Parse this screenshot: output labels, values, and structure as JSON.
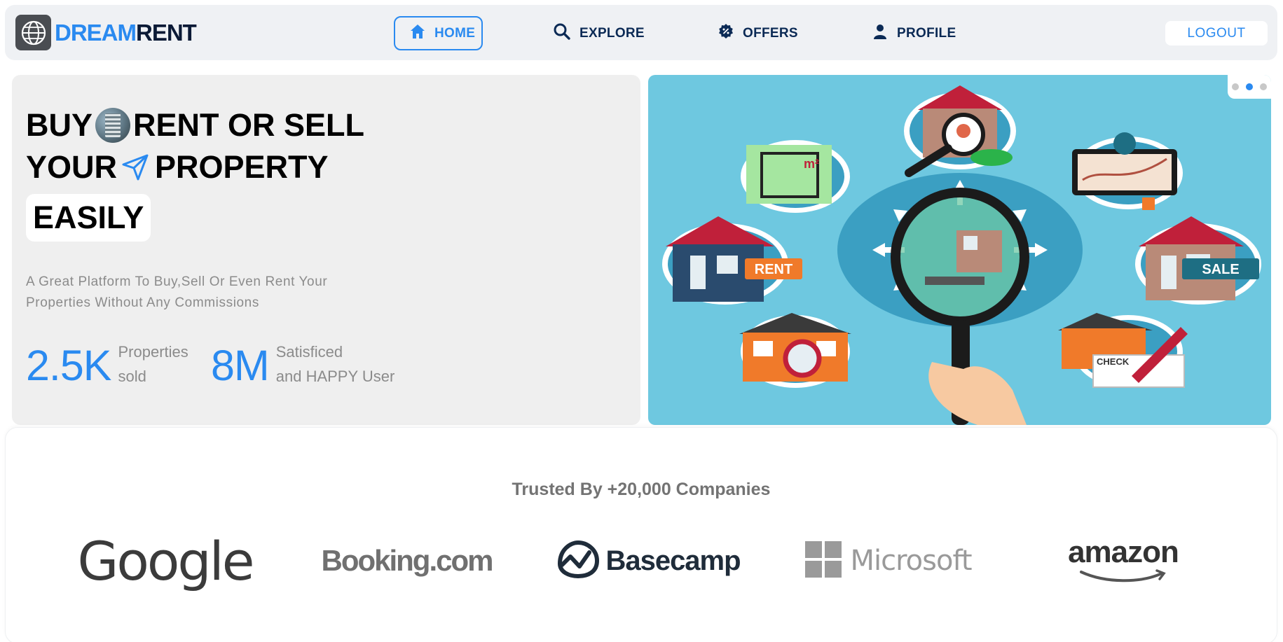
{
  "brand": {
    "part1": "DREAM",
    "part2": "RENT"
  },
  "nav": [
    {
      "label": "HOME",
      "icon": "home-icon"
    },
    {
      "label": "EXPLORE",
      "icon": "search-icon"
    },
    {
      "label": "OFFERS",
      "icon": "offer-badge-icon"
    },
    {
      "label": "PROFILE",
      "icon": "user-icon"
    }
  ],
  "logout_label": "LOGOUT",
  "hero": {
    "line1_a": "BUY",
    "line1_b": "RENT OR SELL",
    "line2_a": "YOUR",
    "line2_b": "PROPERTY",
    "line3": "EASILY",
    "subtitle": "A Great Platform To Buy,Sell Or Even Rent Your Properties Without Any Commissions",
    "stats": [
      {
        "value": "2.5K",
        "label1": "Properties",
        "label2": "sold"
      },
      {
        "value": "8M",
        "label1": "Satisficed",
        "label2": "and HAPPY User"
      }
    ],
    "illustration_labels": {
      "rent": "RENT",
      "sale": "SALE",
      "check": "CHECK",
      "area": "m²"
    }
  },
  "trusted": {
    "title": "Trusted By +20,000 Companies",
    "logos": [
      "Google",
      "Booking.com",
      "Basecamp",
      "Microsoft",
      "amazon"
    ]
  },
  "colors": {
    "accent": "#2a8af0",
    "navy": "#0b2a55",
    "navbar_bg": "#eff1f4",
    "hero_left_bg": "#efefef",
    "hero_right_bg": "#6ec8e0"
  }
}
